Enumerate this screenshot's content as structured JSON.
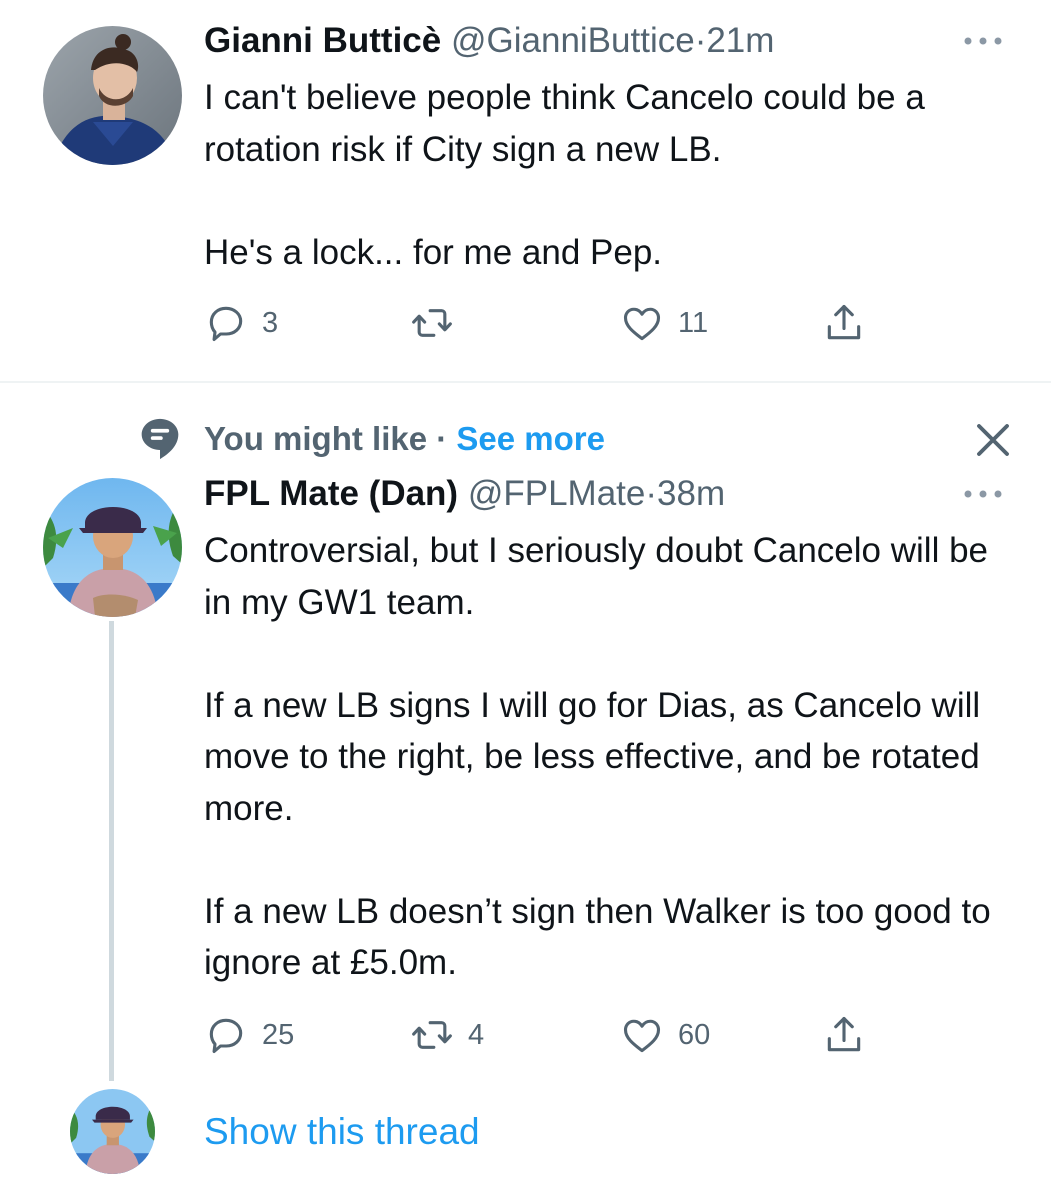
{
  "tweet1": {
    "display_name": "Gianni Butticè",
    "handle": "@GianniButtice",
    "separator": "·",
    "time": "21m",
    "paragraphs": [
      "I can't believe people think Cancelo could be a rotation risk if City sign a new LB.",
      "He's a lock... for me and Pep."
    ],
    "reply_count": "3",
    "retweet_count": "",
    "like_count": "11"
  },
  "suggestion": {
    "label": "You might like",
    "separator": "·",
    "see_more": "See more"
  },
  "tweet2": {
    "display_name": "FPL Mate (Dan)",
    "handle": "@FPLMate",
    "separator": "·",
    "time": "38m",
    "paragraphs": [
      "Controversial, but I seriously doubt Cancelo will be in my GW1 team.",
      "If a new LB signs I will go for Dias, as Cancelo will move to the right, be less effective, and be rotated more.",
      "If a new LB doesn’t sign then Walker is too good to ignore at £5.0m."
    ],
    "reply_count": "25",
    "retweet_count": "4",
    "like_count": "60"
  },
  "thread": {
    "show_label": "Show this thread"
  },
  "colors": {
    "text": "#0f1419",
    "secondary": "#536471",
    "accent": "#1d9bf0",
    "divider": "#eff3f4",
    "thread_line": "#cfd9de"
  },
  "icons": {
    "reply": "reply-icon",
    "retweet": "retweet-icon",
    "like": "heart-icon",
    "share": "share-icon",
    "more": "more-dots-icon",
    "context": "speech-bubble-icon",
    "close": "close-icon"
  }
}
